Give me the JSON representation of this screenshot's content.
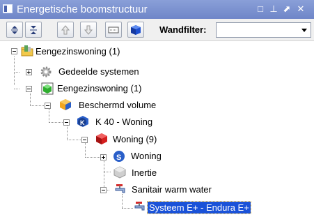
{
  "window": {
    "title": "Energetische boomstructuur",
    "controls": [
      "□",
      "⊥",
      "⬈",
      "✕"
    ]
  },
  "toolbar": {
    "tools": [
      "expand-all",
      "collapse-all",
      "move-up",
      "move-down",
      "keyboard",
      "cube"
    ],
    "filter_label": "Wandfilter:",
    "filter_value": ""
  },
  "tree": {
    "nodes": [
      {
        "label": "Eengezinswoning (1)",
        "icon": "building-folder-icon",
        "expander": "minus"
      },
      {
        "label": "Gedeelde systemen",
        "icon": "gear-icon",
        "expander": "plus"
      },
      {
        "label": "Eengezinswoning (1)",
        "icon": "green-cube-icon",
        "expander": "minus"
      },
      {
        "label": "Beschermd volume",
        "icon": "orange-blue-cube-icon",
        "expander": "minus"
      },
      {
        "label": "K 40 - Woning",
        "icon": "k-badge-icon",
        "expander": "minus"
      },
      {
        "label": "Woning (9)",
        "icon": "red-cube-icon",
        "expander": "minus"
      },
      {
        "label": "Woning",
        "icon": "blue-gear-icon",
        "expander": "plus"
      },
      {
        "label": "Inertie",
        "icon": "grey-cube-icon",
        "expander": "none"
      },
      {
        "label": "Sanitair warm water",
        "icon": "tap-icon",
        "expander": "minus"
      },
      {
        "label": "Systeem E+ - Endura E+",
        "icon": "tap-icon",
        "expander": "none",
        "selected": true
      }
    ]
  },
  "colors": {
    "titlebar": "#7b90d0",
    "selection": "#1a52d8"
  }
}
